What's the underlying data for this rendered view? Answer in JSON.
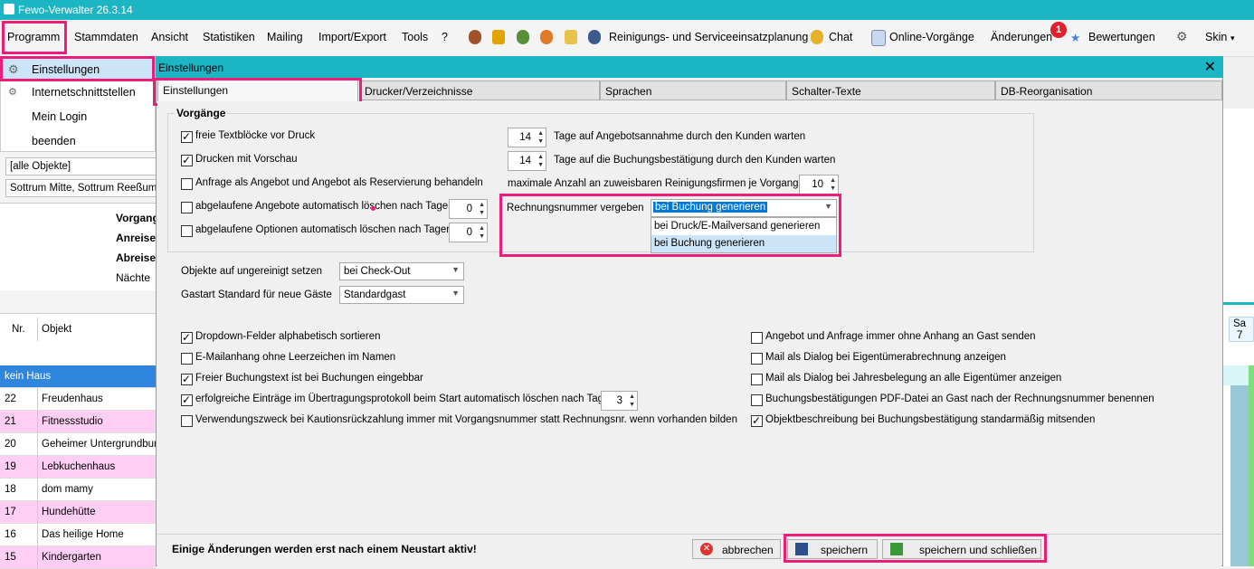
{
  "app": {
    "title": "Fewo-Verwalter 26.3.14"
  },
  "menu": {
    "items": [
      "Programm",
      "Stammdaten",
      "Ansicht",
      "Statistiken",
      "Mailing",
      "Import/Export",
      "Tools",
      "?"
    ],
    "reinigung": "Reinigungs- und Serviceeinsatzplanung",
    "chat": "Chat",
    "online": "Online-Vorgänge",
    "aenderungen": "Änderungen",
    "badge": "1",
    "bewertungen": "Bewertungen",
    "skin": "Skin"
  },
  "programm_menu": {
    "items": [
      "Einstellungen",
      "Internetschnittstellen",
      "Mein Login",
      "beenden"
    ]
  },
  "left": {
    "filter1": "[alle Objekte]",
    "filter2": "Sottrum Mitte, Sottrum Reeßum",
    "labels": [
      "Vorgang",
      "Anreise",
      "Abreise",
      "Nächte"
    ],
    "col_nr": "Nr.",
    "col_obj": "Objekt",
    "rows": [
      {
        "nr": "",
        "obj": "kein Haus",
        "color": "#2e86de"
      },
      {
        "nr": "22",
        "obj": "Freudenhaus",
        "color": "#ffffff"
      },
      {
        "nr": "21",
        "obj": "Fitnessstudio",
        "color": "#ffcef5"
      },
      {
        "nr": "20",
        "obj": "Geheimer Untergrundbunker",
        "color": "#ffffff"
      },
      {
        "nr": "19",
        "obj": "Lebkuchenhaus",
        "color": "#ffcef5"
      },
      {
        "nr": "18",
        "obj": "dom mamy",
        "color": "#ffffff"
      },
      {
        "nr": "17",
        "obj": "Hundehütte",
        "color": "#ffcef5"
      },
      {
        "nr": "16",
        "obj": "Das heilige Home",
        "color": "#ffffff"
      },
      {
        "nr": "15",
        "obj": "Kindergarten",
        "color": "#ffcef5"
      }
    ]
  },
  "calendar": {
    "day": "Sa",
    "date": "7"
  },
  "dialog": {
    "title": "Einstellungen",
    "tabs": [
      "Einstellungen",
      "Drucker/Verzeichnisse",
      "Sprachen",
      "Schalter-Texte",
      "DB-Reorganisation"
    ],
    "group_title": "Vorgänge",
    "checks_top": [
      {
        "label": "freie Textblöcke vor Druck",
        "on": true
      },
      {
        "label": "Drucken mit Vorschau",
        "on": true
      },
      {
        "label": "Anfrage als Angebot und Angebot als Reservierung behandeln",
        "on": false
      },
      {
        "label": "abgelaufene Angebote automatisch löschen nach Tagen",
        "on": false
      },
      {
        "label": "abgelaufene Optionen automatisch löschen nach Tagen",
        "on": false
      }
    ],
    "spin_angebot_del": "0",
    "spin_option_del": "0",
    "spin_angebot_wait": "14",
    "label_angebot_wait": "Tage auf Angebotsannahme durch den Kunden warten",
    "spin_buchung_wait": "14",
    "label_buchung_wait": "Tage auf die Buchungsbestätigung durch den Kunden warten",
    "label_reinigung": "maximale Anzahl an zuweisbaren Reinigungsfirmen je Vorgang",
    "spin_reinigung": "10",
    "rechnung_label": "Rechnungsnummer vergeben",
    "rechnung_value": "bei Buchung generieren",
    "rechnung_options": [
      "bei Druck/E-Mailversand generieren",
      "bei Buchung generieren"
    ],
    "ungereinigt_label": "Objekte auf ungereinigt setzen",
    "ungereinigt_value": "bei Check-Out",
    "gastart_label": "Gastart Standard für neue Gäste",
    "gastart_value": "Standardgast",
    "checks_left": [
      {
        "label": "Dropdown-Felder alphabetisch sortieren",
        "on": true
      },
      {
        "label": "E-Mailanhang ohne Leerzeichen im Namen",
        "on": false
      },
      {
        "label": "Freier Buchungstext ist bei Buchungen eingebbar",
        "on": true
      },
      {
        "label": "erfolgreiche Einträge im Übertragungsprotokoll beim Start automatisch löschen nach Tagen",
        "on": true
      },
      {
        "label": "Verwendungszweck bei Kautionsrückzahlung immer mit Vorgangsnummer statt Rechnungsnr. wenn vorhanden bilden",
        "on": false
      }
    ],
    "spin_protokoll": "3",
    "checks_right": [
      {
        "label": "Angebot und Anfrage immer ohne Anhang an Gast senden",
        "on": false
      },
      {
        "label": "Mail als Dialog bei Eigentümerabrechnung anzeigen",
        "on": false
      },
      {
        "label": "Mail als Dialog bei Jahresbelegung an alle Eigentümer anzeigen",
        "on": false
      },
      {
        "label": "Buchungsbestätigungen PDF-Datei an Gast  nach  der Rechnungsnummer benennen",
        "on": false
      },
      {
        "label": "Objektbeschreibung bei Buchungsbestätigung standarmäßig mitsenden",
        "on": true
      }
    ],
    "footer_note": "Einige Änderungen werden erst nach einem Neustart aktiv!",
    "btn_cancel": "abbrechen",
    "btn_save": "speichern",
    "btn_save_close": "speichern und schließen"
  }
}
